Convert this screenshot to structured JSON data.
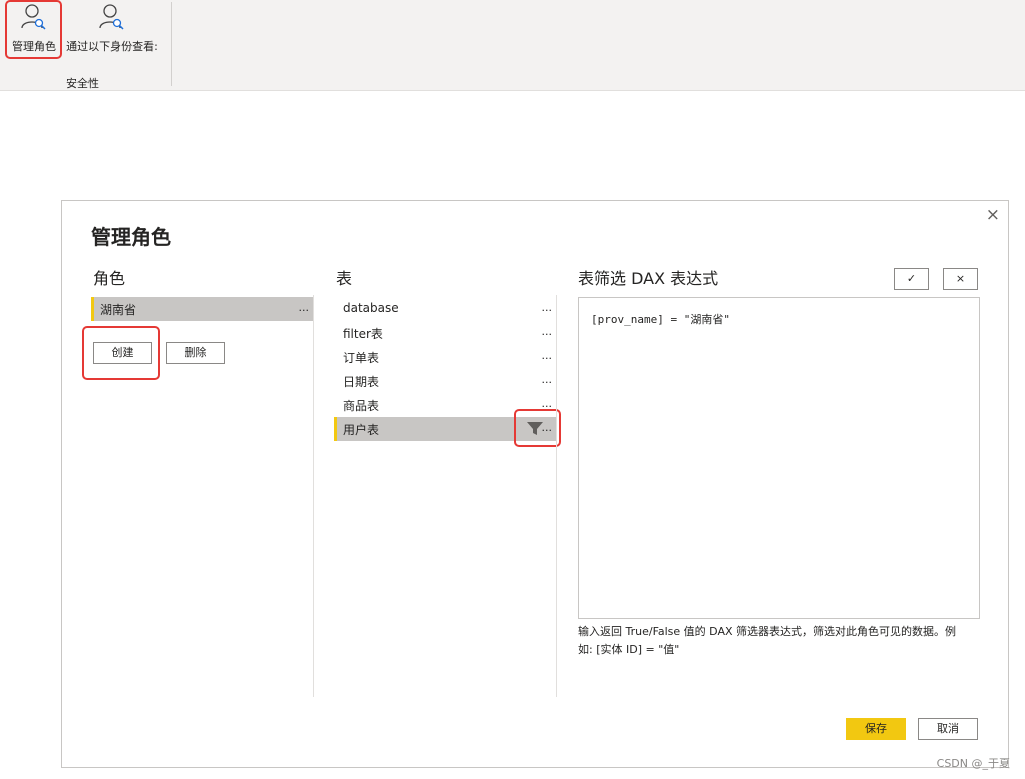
{
  "ribbon": {
    "manage_roles_label": "管理角色",
    "view_as_label": "通过以下身份查看:",
    "group_label": "安全性"
  },
  "dialog": {
    "title": "管理角色",
    "close_glyph": "×",
    "roles": {
      "header": "角色",
      "items": [
        {
          "name": "湖南省",
          "more": "..."
        }
      ],
      "create_label": "创建",
      "delete_label": "删除"
    },
    "tables": {
      "header": "表",
      "items": [
        {
          "name": "database",
          "more": "..."
        },
        {
          "name": "filter表",
          "more": "..."
        },
        {
          "name": "订单表",
          "more": "..."
        },
        {
          "name": "日期表",
          "more": "..."
        },
        {
          "name": "商品表",
          "more": "..."
        },
        {
          "name": "用户表",
          "more": "..."
        }
      ],
      "selected_index": 5
    },
    "dax": {
      "header": "表筛选 DAX 表达式",
      "confirm_glyph": "✓",
      "cancel_glyph": "×",
      "expression": "[prov_name] = \"湖南省\"",
      "help_text": "输入返回 True/False 值的 DAX 筛选器表达式，筛选对此角色可见的数据。例如: [实体 ID] = \"值\""
    },
    "save_label": "保存",
    "cancel_label": "取消"
  },
  "watermark": "CSDN @_于夏",
  "colors": {
    "accent": "#f2c811",
    "highlight": "#e53935",
    "selected_row": "#c8c6c4"
  }
}
